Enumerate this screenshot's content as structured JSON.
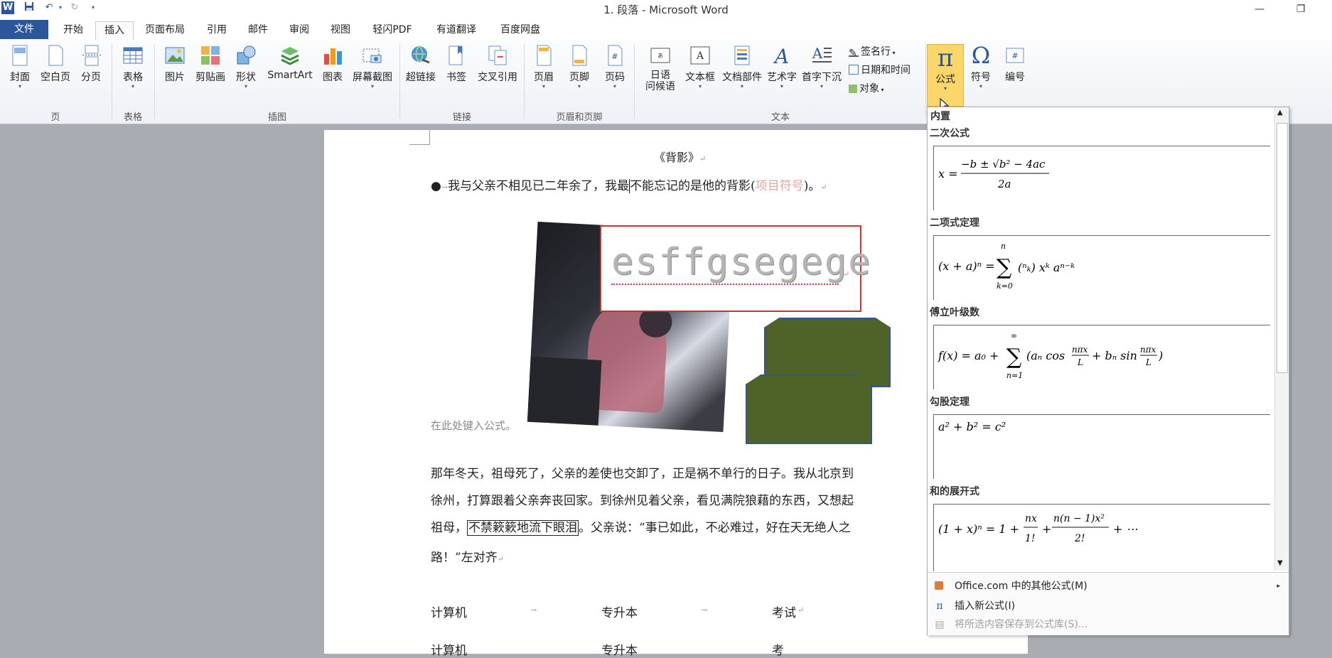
{
  "window": {
    "title": "1. 段落 - Microsoft Word",
    "app_icon": "word-icon",
    "qat": [
      "save-icon",
      "undo-icon",
      "redo-icon",
      "customize-icon"
    ]
  },
  "tabs": [
    "文件",
    "开始",
    "插入",
    "页面布局",
    "引用",
    "邮件",
    "审阅",
    "视图",
    "轻闪PDF",
    "有道翻译",
    "百度网盘"
  ],
  "active_tab": "插入",
  "ribbon": {
    "groups": {
      "pages": "页",
      "tables": "表格",
      "illustrations": "插图",
      "links": "链接",
      "header_footer": "页眉和页脚",
      "text": "文本"
    },
    "buttons": {
      "cover": "封面",
      "blank": "空白页",
      "break": "分页",
      "table": "表格",
      "picture": "图片",
      "clipart": "剪贴画",
      "shapes": "形状",
      "smartart": "SmartArt",
      "chart": "图表",
      "screenshot": "屏幕截图",
      "hyperlink": "超链接",
      "bookmark": "书签",
      "crossref": "交叉引用",
      "header": "页眉",
      "footer": "页脚",
      "pagenum": "页码",
      "phonetic_1": "日语",
      "phonetic_2": "问候语",
      "textbox": "文本框",
      "quickparts": "文档部件",
      "wordart": "艺术字",
      "dropcap": "首字下沉",
      "signature": "签名行",
      "datetime": "日期和时间",
      "object": "对象",
      "equation": "公式",
      "symbol": "符号",
      "numbering": "编号"
    }
  },
  "document": {
    "title_line": "《背影》",
    "line1_a": "我与父亲不相见已二年余了，我最",
    "line1_b": "不能忘记的是他的背影(",
    "line1_red": "项目符号",
    "line1_c": ")。",
    "wordart_text": "esffgsegege",
    "equation_placeholder": "在此处键入公式。",
    "para_line1": "那年冬天，祖母死了，父亲的差使也交卸了，正是祸不单行的日子。我从北京到",
    "para_line2": "徐州，打算跟着父亲奔丧回家。到徐州见着父亲，看见满院狼藉的东西，又想起",
    "para_line3_a": "祖母，",
    "para_line3_boxed": "不禁簌簌地流下眼泪",
    "para_line3_b": "。父亲说：“事已如此，不必难过，好在天无绝人之",
    "para_line4": "路！”左对齐",
    "tab_row1": [
      "计算机",
      "专升本",
      "考试"
    ],
    "tab_row2": [
      "计算机",
      "专升本",
      "考"
    ]
  },
  "gallery": {
    "header": "内置",
    "items": [
      {
        "name": "二次公式"
      },
      {
        "name": "二项式定理"
      },
      {
        "name": "傅立叶级数"
      },
      {
        "name": "勾股定理"
      },
      {
        "name": "和的展开式"
      }
    ],
    "menu": [
      {
        "label": "Office.com 中的其他公式(M)",
        "icon": "office-icon",
        "enabled": true
      },
      {
        "label": "插入新公式(I)",
        "icon": "pi-icon",
        "enabled": true
      },
      {
        "label": "将所选内容保存到公式库(S)...",
        "icon": "save-selection-icon",
        "enabled": false
      }
    ]
  },
  "colors": {
    "file_tab": "#2b579a",
    "shape_fill": "#4f6228",
    "shape_border": "#2f5597",
    "equation_highlight": "#fbd76b",
    "wordart_border": "#c0392b"
  }
}
